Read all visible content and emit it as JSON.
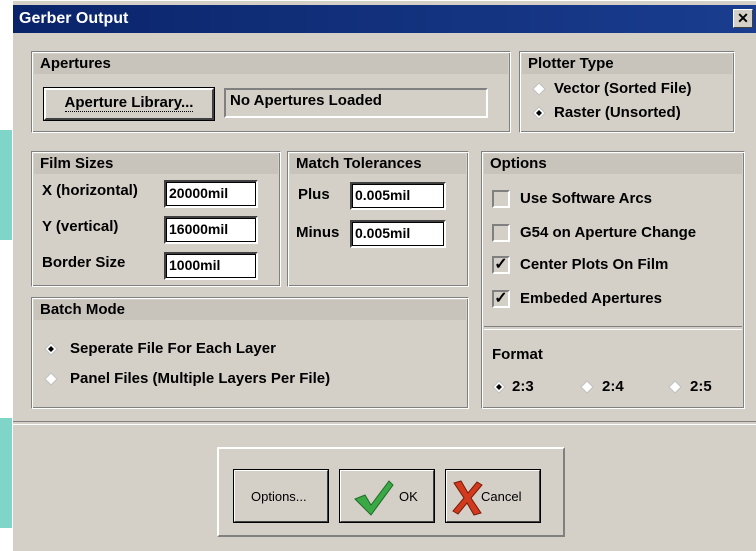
{
  "window": {
    "title": "Gerber Output",
    "close_symbol": "✕"
  },
  "apertures": {
    "header": "Apertures",
    "library_button": "Aperture Library...",
    "status": "No Apertures Loaded"
  },
  "plotter_type": {
    "header": "Plotter Type",
    "options": [
      {
        "label": "Vector (Sorted File)",
        "selected": false
      },
      {
        "label": "Raster (Unsorted)",
        "selected": true
      }
    ]
  },
  "film_sizes": {
    "header": "Film Sizes",
    "x_label": "X (horizontal)",
    "x_value": "20000mil",
    "y_label": "Y (vertical)",
    "y_value": "16000mil",
    "border_label": "Border Size",
    "border_value": "1000mil"
  },
  "match_tolerances": {
    "header": "Match Tolerances",
    "plus_label": "Plus",
    "plus_value": "0.005mil",
    "minus_label": "Minus",
    "minus_value": "0.005mil"
  },
  "options": {
    "header": "Options",
    "checks": [
      {
        "label": "Use Software Arcs",
        "checked": false
      },
      {
        "label": "G54 on Aperture Change",
        "checked": false
      },
      {
        "label": "Center Plots On Film",
        "checked": true
      },
      {
        "label": "Embeded Apertures",
        "checked": true
      }
    ],
    "check_mark": "✓",
    "format_label": "Format",
    "formats": [
      {
        "label": "2:3",
        "selected": true
      },
      {
        "label": "2:4",
        "selected": false
      },
      {
        "label": "2:5",
        "selected": false
      }
    ]
  },
  "batch_mode": {
    "header": "Batch Mode",
    "options": [
      {
        "label": "Seperate File For Each Layer",
        "selected": true
      },
      {
        "label": "Panel Files (Multiple Layers Per File)",
        "selected": false
      }
    ]
  },
  "buttons": {
    "options": "Options...",
    "ok": "OK",
    "cancel": "Cancel"
  },
  "colors": {
    "titlebar": "#0a246a",
    "dialog": "#d4d0c8",
    "ok_check": "#3aa845",
    "cancel_x": "#d23a1e"
  }
}
